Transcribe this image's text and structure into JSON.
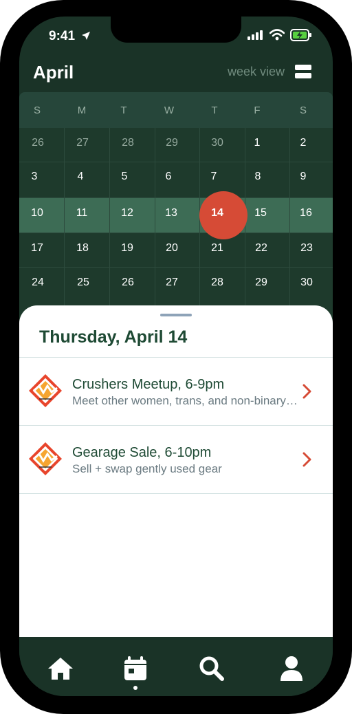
{
  "status_bar": {
    "time": "9:41"
  },
  "header": {
    "month": "April",
    "view_toggle_label": "week view"
  },
  "calendar": {
    "weekdays": [
      "S",
      "M",
      "T",
      "W",
      "T",
      "F",
      "S"
    ],
    "weeks": [
      [
        "26",
        "27",
        "28",
        "29",
        "30",
        "1",
        "2"
      ],
      [
        "3",
        "4",
        "5",
        "6",
        "7",
        "8",
        "9"
      ],
      [
        "10",
        "11",
        "12",
        "13",
        "14",
        "15",
        "16"
      ],
      [
        "17",
        "18",
        "19",
        "20",
        "21",
        "22",
        "23"
      ],
      [
        "24",
        "25",
        "26",
        "27",
        "28",
        "29",
        "30"
      ]
    ],
    "selected_day": "14"
  },
  "sheet": {
    "title": "Thursday, April 14",
    "events": [
      {
        "title": "Crushers Meetup, 6-9pm",
        "subtitle": "Meet other women, trans, and non-binary climbers"
      },
      {
        "title": "Gearage Sale, 6-10pm",
        "subtitle": "Sell + swap gently used gear"
      }
    ]
  },
  "tabs": {
    "active": "calendar"
  },
  "icons": [
    "location-arrow-icon",
    "signal-icon",
    "wifi-icon",
    "battery-charging-icon",
    "list-toggle-icon",
    "event-logo-icon",
    "chevron-right-icon",
    "home-icon",
    "calendar-icon",
    "search-icon",
    "profile-icon"
  ],
  "colors": {
    "background": "#1a3327",
    "today": "#d64b36",
    "week_highlight": "#3d6c55",
    "title_green": "#1e4a34",
    "chevron": "#d64b36"
  }
}
